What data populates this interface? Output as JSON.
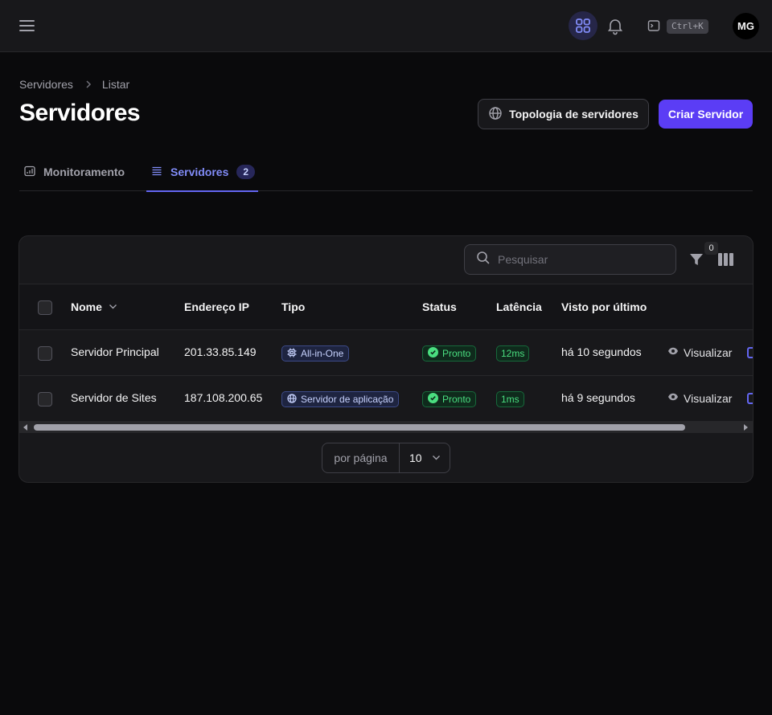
{
  "topbar": {
    "shortcut": "Ctrl+K",
    "avatar_initials": "MG",
    "icons": [
      "menu-icon",
      "apps-grid-icon",
      "bell-icon",
      "command-icon"
    ]
  },
  "breadcrumb": {
    "root": "Servidores",
    "current": "Listar"
  },
  "header": {
    "title": "Servidores",
    "topology_button": "Topologia de servidores",
    "create_button": "Criar Servidor"
  },
  "tabs": [
    {
      "label": "Monitoramento",
      "icon": "chart-icon",
      "active": false
    },
    {
      "label": "Servidores",
      "icon": "list-icon",
      "active": true,
      "badge": "2"
    }
  ],
  "table": {
    "search_placeholder": "Pesquisar",
    "filter_count": "0",
    "columns": [
      "Nome",
      "Endereço IP",
      "Tipo",
      "Status",
      "Latência",
      "Visto por último"
    ],
    "rows": [
      {
        "name": "Servidor Principal",
        "ip": "201.33.85.149",
        "type": "All-in-One",
        "type_icon": "cpu-icon",
        "status": "Pronto",
        "latency": "12ms",
        "last_seen": "há 10 segundos",
        "view": "Visualizar"
      },
      {
        "name": "Servidor de Sites",
        "ip": "187.108.200.65",
        "type": "Servidor de aplicação",
        "type_icon": "globe-icon",
        "status": "Pronto",
        "latency": "1ms",
        "last_seen": "há 9 segundos",
        "view": "Visualizar"
      }
    ],
    "pagination": {
      "label": "por página",
      "value": "10"
    }
  },
  "colors": {
    "accent": "#5b3df5",
    "tab_active": "#818cf8",
    "success": "#4ade80"
  }
}
